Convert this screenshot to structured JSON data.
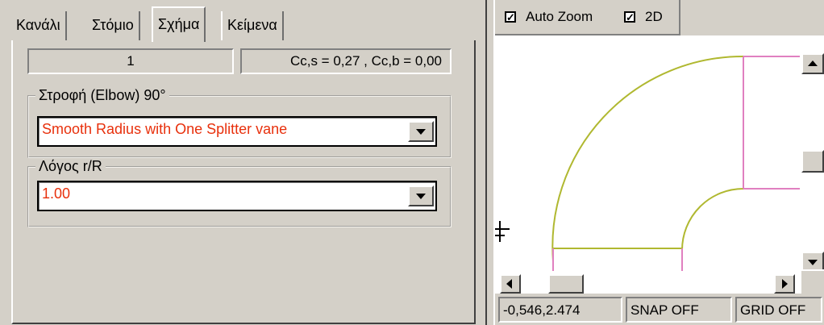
{
  "tabs": [
    {
      "label": "Κανάλι",
      "active": false
    },
    {
      "label": "Στόμιο",
      "active": false
    },
    {
      "label": "Σχήμα",
      "active": true
    },
    {
      "label": "Κείμενα",
      "active": false
    }
  ],
  "shape_panel": {
    "index_value": "1",
    "coefficients": "Cc,s = 0,27 , Cc,b = 0,00",
    "elbow_group": {
      "legend": "Στροφή (Elbow) 90°",
      "selected": "Smooth Radius with One Splitter vane"
    },
    "ratio_group": {
      "legend": "Λόγος r/R",
      "selected": "1.00"
    }
  },
  "view_toolbar": {
    "auto_zoom": {
      "label": "Auto Zoom",
      "checked": true
    },
    "two_d": {
      "label": "2D",
      "checked": true
    }
  },
  "status_bar": {
    "coordinates": "-0,546,2.474",
    "snap": "SNAP OFF",
    "grid": "GRID OFF"
  },
  "colors": {
    "window_face": "#d4d0c8",
    "combo_value": "#e8300c",
    "elbow_outline": "#b0b830",
    "splitter_line": "#e080c0"
  }
}
